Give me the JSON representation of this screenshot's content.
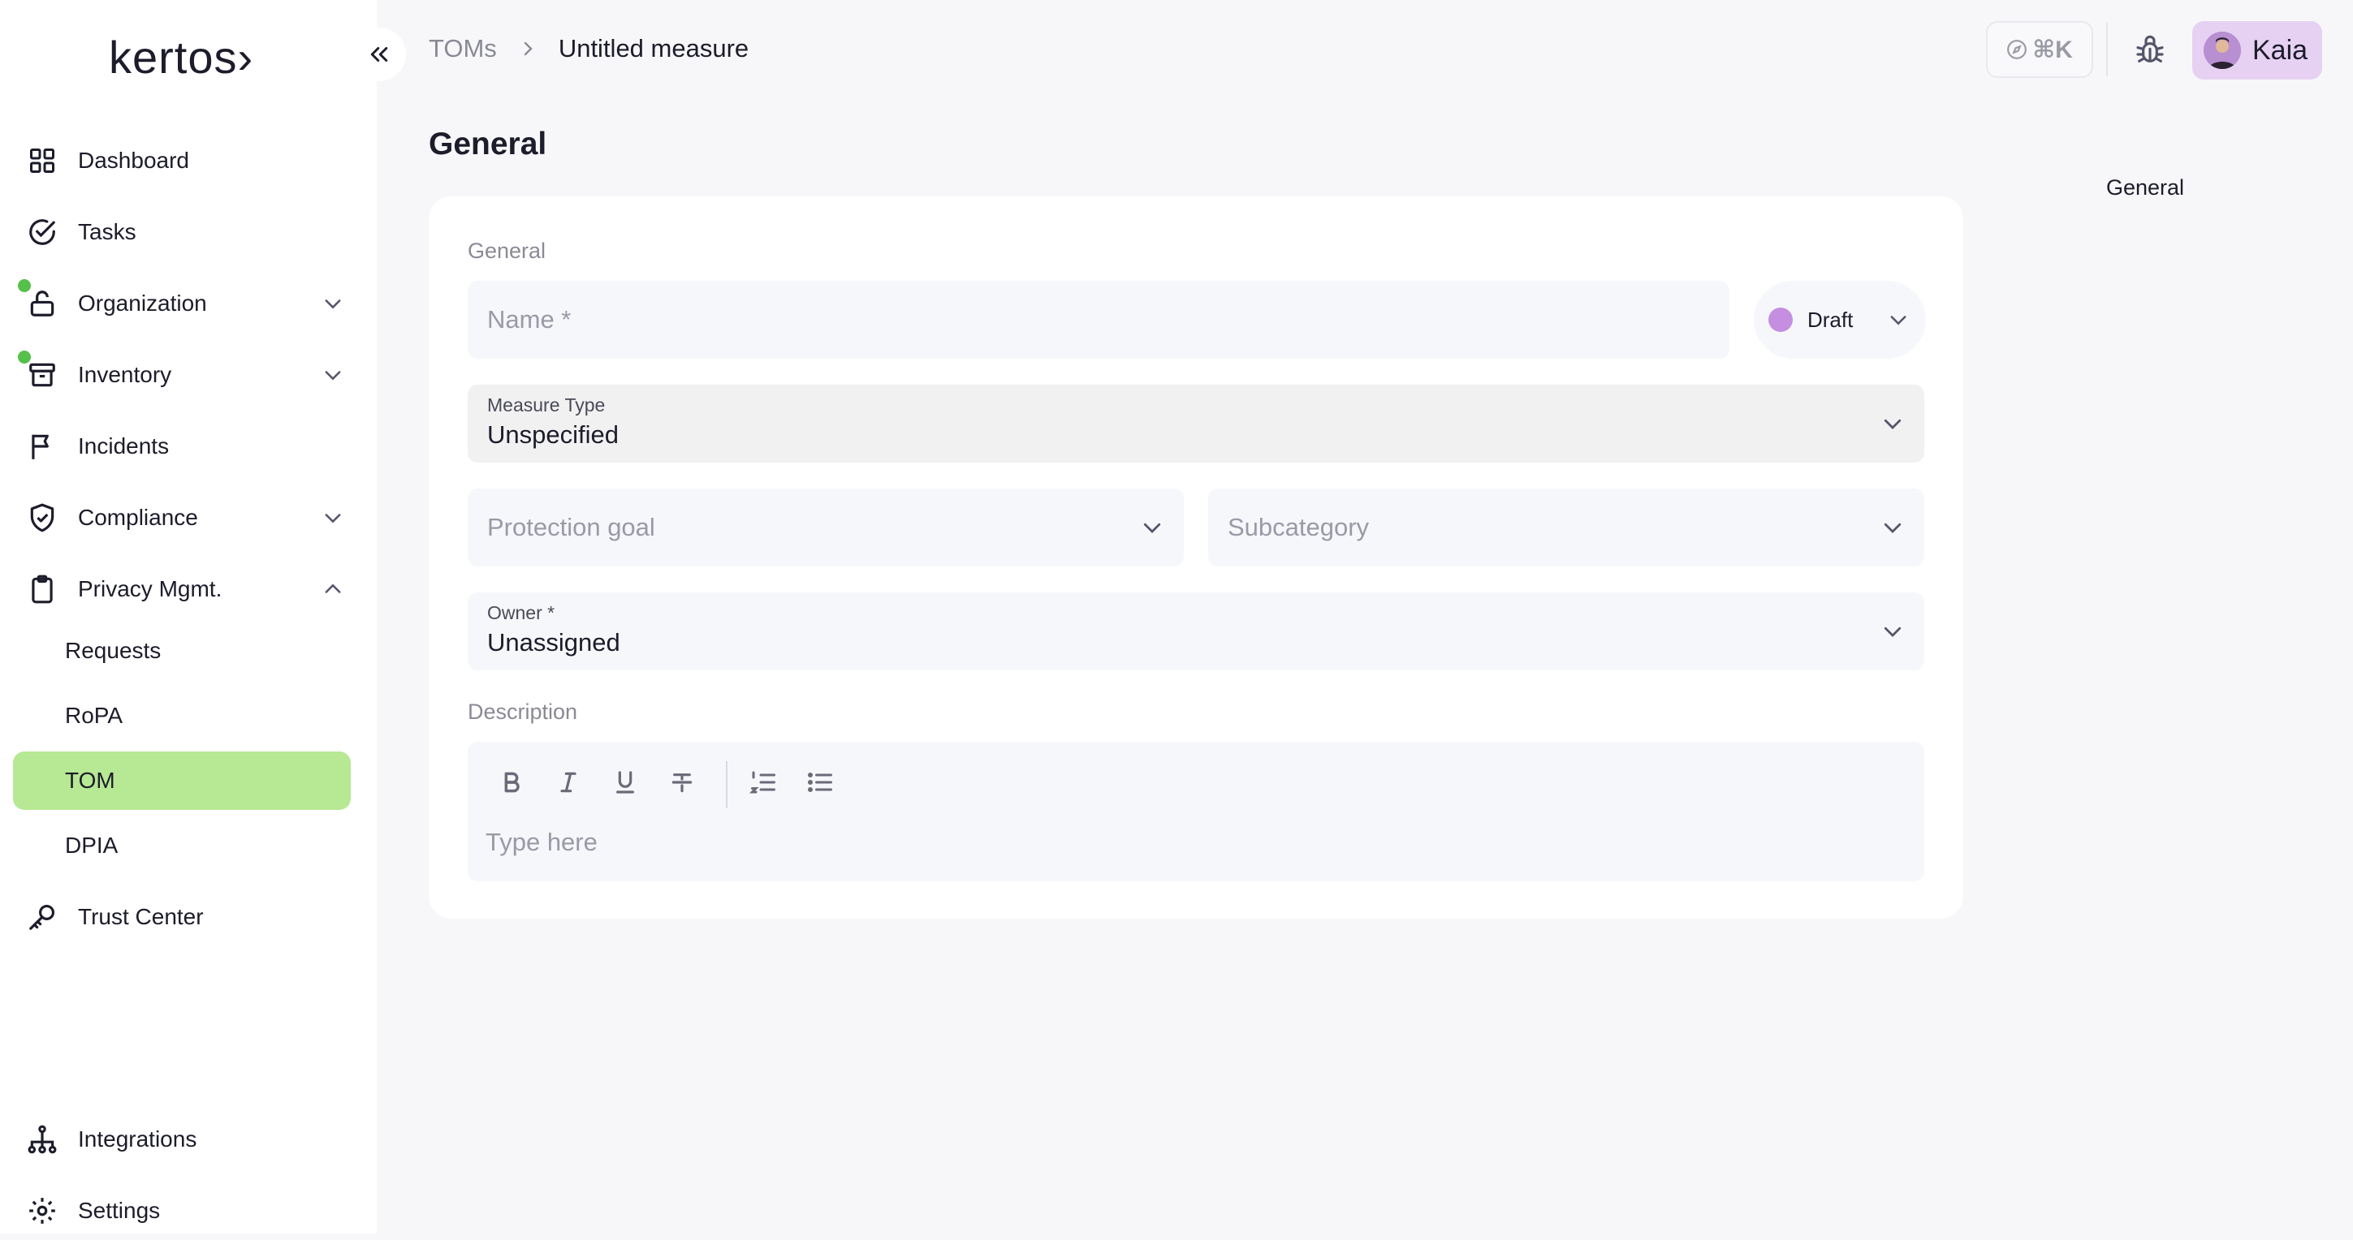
{
  "sidebar": {
    "logo": "kertos›",
    "items": [
      {
        "label": "Dashboard"
      },
      {
        "label": "Tasks"
      },
      {
        "label": "Organization"
      },
      {
        "label": "Inventory"
      },
      {
        "label": "Incidents"
      },
      {
        "label": "Compliance"
      },
      {
        "label": "Privacy Mgmt."
      }
    ],
    "subitems": [
      {
        "label": "Requests"
      },
      {
        "label": "RoPA"
      },
      {
        "label": "TOM"
      },
      {
        "label": "DPIA"
      }
    ],
    "trust_center": "Trust Center",
    "bottom": [
      {
        "label": "Integrations"
      },
      {
        "label": "Settings"
      }
    ]
  },
  "breadcrumb": {
    "root": "TOMs",
    "current": "Untitled measure"
  },
  "topbar": {
    "shortcut": "⌘K",
    "user_name": "Kaia"
  },
  "page": {
    "title": "General",
    "toc_link": "General"
  },
  "form": {
    "section_label": "General",
    "name_placeholder": "Name *",
    "status": "Draft",
    "measure_type_label": "Measure Type",
    "measure_type_value": "Unspecified",
    "protection_goal_placeholder": "Protection goal",
    "subcategory_placeholder": "Subcategory",
    "owner_label": "Owner *",
    "owner_value": "Unassigned",
    "description_label": "Description",
    "description_placeholder": "Type here"
  },
  "colors": {
    "active_nav": "#b7e893",
    "status_draft": "#c58ee0",
    "notification_dot": "#55c04a",
    "user_badge": "#e6d1f3"
  }
}
